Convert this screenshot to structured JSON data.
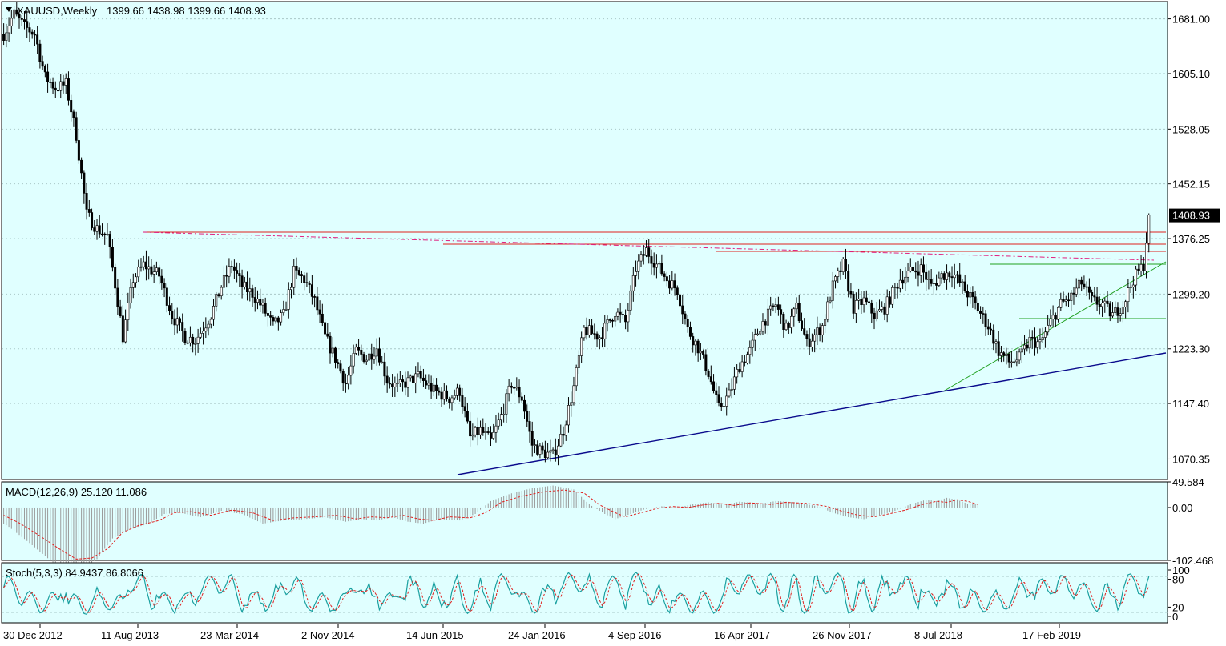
{
  "header": {
    "symbol_label": "XAUUSD,Weekly",
    "ohlc": "1399.66 1438.98 1399.66 1408.93"
  },
  "colors": {
    "background": "#e0ffff",
    "axis_area": "#ffffff",
    "candle": "#000000",
    "resistance": "#e0201e",
    "dashed_resistance": "#e0207f",
    "support_trendline": "#0a0a8c",
    "green_lines": "#1fa01f",
    "macd_signal": "#e0201e",
    "macd_hist": "#9a9a9a",
    "stoch_main": "#1aa0a0",
    "stoch_signal": "#e0201e",
    "grid": "#a9c8c8"
  },
  "chart_data": [
    {
      "type": "candlestick",
      "title": "XAUUSD,Weekly",
      "price_axis_ticks": [
        "1681.00",
        "1605.10",
        "1528.05",
        "1452.15",
        "1376.25",
        "1299.20",
        "1223.30",
        "1147.40",
        "1070.35"
      ],
      "price_axis_values": [
        1681.0,
        1605.1,
        1528.05,
        1452.15,
        1376.25,
        1299.2,
        1223.3,
        1147.4,
        1070.35
      ],
      "current_price_label": "1408.93",
      "current_price": 1408.93,
      "date_axis_ticks": [
        "30 Dec 2012",
        "11 Aug 2013",
        "23 Mar 2014",
        "2 Nov 2014",
        "14 Jun 2015",
        "24 Jan 2016",
        "4 Sep 2016",
        "16 Apr 2017",
        "26 Nov 2017",
        "8 Jul 2018",
        "17 Feb 2019"
      ],
      "ylim": [
        1042,
        1705
      ],
      "grid": true,
      "bar_count": 344,
      "path_anchors": [
        [
          0,
          1660
        ],
        [
          4,
          1688
        ],
        [
          8,
          1670
        ],
        [
          12,
          1660
        ],
        [
          16,
          1600
        ],
        [
          20,
          1585
        ],
        [
          24,
          1590
        ],
        [
          28,
          1520
        ],
        [
          32,
          1410
        ],
        [
          36,
          1390
        ],
        [
          40,
          1380
        ],
        [
          44,
          1290
        ],
        [
          46,
          1240
        ],
        [
          50,
          1320
        ],
        [
          54,
          1340
        ],
        [
          60,
          1325
        ],
        [
          65,
          1270
        ],
        [
          70,
          1240
        ],
        [
          74,
          1235
        ],
        [
          80,
          1270
        ],
        [
          84,
          1310
        ],
        [
          88,
          1340
        ],
        [
          92,
          1310
        ],
        [
          96,
          1300
        ],
        [
          100,
          1280
        ],
        [
          104,
          1255
        ],
        [
          108,
          1270
        ],
        [
          112,
          1330
        ],
        [
          116,
          1320
        ],
        [
          120,
          1290
        ],
        [
          124,
          1240
        ],
        [
          128,
          1210
        ],
        [
          132,
          1175
        ],
        [
          136,
          1220
        ],
        [
          140,
          1210
        ],
        [
          144,
          1225
        ],
        [
          148,
          1180
        ],
        [
          152,
          1170
        ],
        [
          160,
          1185
        ],
        [
          166,
          1165
        ],
        [
          172,
          1155
        ],
        [
          176,
          1165
        ],
        [
          180,
          1100
        ],
        [
          184,
          1110
        ],
        [
          188,
          1095
        ],
        [
          192,
          1130
        ],
        [
          196,
          1175
        ],
        [
          200,
          1155
        ],
        [
          204,
          1090
        ],
        [
          208,
          1080
        ],
        [
          212,
          1075
        ],
        [
          216,
          1110
        ],
        [
          220,
          1170
        ],
        [
          224,
          1250
        ],
        [
          230,
          1240
        ],
        [
          236,
          1275
        ],
        [
          240,
          1260
        ],
        [
          244,
          1335
        ],
        [
          248,
          1360
        ],
        [
          252,
          1340
        ],
        [
          256,
          1320
        ],
        [
          260,
          1305
        ],
        [
          264,
          1250
        ],
        [
          268,
          1225
        ],
        [
          272,
          1190
        ],
        [
          276,
          1140
        ],
        [
          280,
          1160
        ],
        [
          284,
          1200
        ],
        [
          288,
          1220
        ],
        [
          292,
          1255
        ],
        [
          298,
          1285
        ],
        [
          302,
          1250
        ],
        [
          306,
          1280
        ],
        [
          310,
          1230
        ],
        [
          316,
          1255
        ],
        [
          320,
          1310
        ],
        [
          324,
          1340
        ],
        [
          328,
          1280
        ],
        [
          332,
          1290
        ],
        [
          336,
          1270
        ],
        [
          340,
          1280
        ],
        [
          346,
          1320
        ],
        [
          350,
          1330
        ],
        [
          354,
          1335
        ],
        [
          358,
          1310
        ],
        [
          362,
          1325
        ],
        [
          366,
          1330
        ],
        [
          370,
          1310
        ],
        [
          374,
          1290
        ],
        [
          380,
          1255
        ],
        [
          384,
          1220
        ],
        [
          388,
          1205
        ],
        [
          392,
          1210
        ],
        [
          396,
          1235
        ],
        [
          400,
          1230
        ],
        [
          404,
          1260
        ],
        [
          408,
          1285
        ],
        [
          412,
          1295
        ],
        [
          416,
          1315
        ],
        [
          420,
          1290
        ],
        [
          424,
          1285
        ],
        [
          428,
          1270
        ],
        [
          432,
          1285
        ],
        [
          436,
          1320
        ],
        [
          440,
          1340
        ],
        [
          442,
          1408
        ]
      ]
    },
    {
      "type": "line",
      "title": "MACD(12,26,9) 25.120 11.086",
      "axis_ticks": [
        "49.584",
        "0.00",
        "-102.468"
      ],
      "ylim": [
        -102.468,
        49.584
      ],
      "signal_anchors": [
        [
          0,
          -15
        ],
        [
          6,
          -30
        ],
        [
          14,
          -55
        ],
        [
          22,
          -82
        ],
        [
          28,
          -100
        ],
        [
          34,
          -98
        ],
        [
          40,
          -80
        ],
        [
          46,
          -48
        ],
        [
          52,
          -35
        ],
        [
          60,
          -25
        ],
        [
          66,
          -10
        ],
        [
          72,
          -8
        ],
        [
          80,
          -15
        ],
        [
          88,
          -5
        ],
        [
          96,
          -10
        ],
        [
          104,
          -25
        ],
        [
          112,
          -20
        ],
        [
          120,
          -18
        ],
        [
          128,
          -15
        ],
        [
          136,
          -22
        ],
        [
          142,
          -18
        ],
        [
          148,
          -20
        ],
        [
          154,
          -15
        ],
        [
          160,
          -22
        ],
        [
          166,
          -25
        ],
        [
          172,
          -18
        ],
        [
          180,
          -20
        ],
        [
          186,
          -10
        ],
        [
          192,
          10
        ],
        [
          200,
          22
        ],
        [
          208,
          30
        ],
        [
          216,
          34
        ],
        [
          224,
          28
        ],
        [
          230,
          5
        ],
        [
          236,
          -10
        ],
        [
          240,
          -18
        ],
        [
          246,
          -10
        ],
        [
          252,
          -2
        ],
        [
          258,
          2
        ],
        [
          264,
          0
        ],
        [
          270,
          5
        ],
        [
          276,
          8
        ],
        [
          282,
          4
        ],
        [
          288,
          9
        ],
        [
          296,
          6
        ],
        [
          302,
          10
        ],
        [
          310,
          8
        ],
        [
          318,
          2
        ],
        [
          324,
          -8
        ],
        [
          330,
          -15
        ],
        [
          336,
          -18
        ],
        [
          342,
          -12
        ],
        [
          348,
          -5
        ],
        [
          354,
          5
        ],
        [
          360,
          12
        ],
        [
          364,
          10
        ],
        [
          368,
          15
        ],
        [
          372,
          12
        ],
        [
          376,
          6
        ]
      ],
      "hist_offset": 4,
      "hist_scale": 1.25
    },
    {
      "type": "line",
      "title": "Stoch(5,3,3) 84.9437 86.8066",
      "axis_ticks": [
        "100",
        "80",
        "20",
        "0"
      ],
      "ylim": [
        0,
        100
      ],
      "period_bars": 26,
      "cycle_phase_offset": 0.6
    }
  ]
}
